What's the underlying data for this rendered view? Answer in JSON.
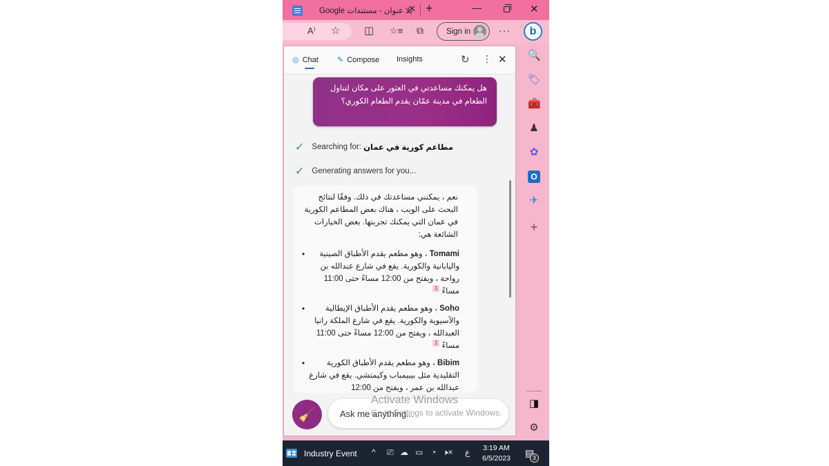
{
  "browser": {
    "tab_title": "بلا عنوان - مستندات Google",
    "tab_close": "✕",
    "new_tab": "+",
    "window_controls": {
      "minimize": "—",
      "close": "✕"
    },
    "toolbar": {
      "read_aloud": "A⁾",
      "favorite": "☆",
      "split_screen": "◫",
      "favorites": "☆≡",
      "collections": "⧉",
      "sign_in_label": "Sign in",
      "more": "···",
      "copilot": "b"
    }
  },
  "panel": {
    "tabs": [
      {
        "label": "Chat",
        "icon": "chat-icon",
        "active": true
      },
      {
        "label": "Compose",
        "icon": "compose-icon",
        "active": false
      },
      {
        "label": "Insights",
        "active": false
      }
    ],
    "refresh": "↻",
    "more": "⋮",
    "close": "✕",
    "user_message": "هل يمكنك مساعدتي في العثور على مكان لتناول الطعام في مدينة عمّان يقدم الطعام الكوري؟",
    "status": [
      {
        "prefix": "Searching for: ",
        "query": "مطاعم كورية في عمان"
      },
      {
        "prefix": "Generating answers for you...",
        "query": ""
      }
    ],
    "answer": {
      "intro": "نعم ، يمكنني مساعدتك في ذلك. وفقًا لنتائج البحث على الويب ، هناك بعض المطاعم الكورية في عمان التي يمكنك تجربتها. بعض الخيارات الشائعة هي:",
      "items": [
        {
          "name": "Tomami",
          "text": "، وهو مطعم يقدم الأطباق الصينية واليابانية والكورية. يقع في شارع عبدالله بن رواحة ، ويفتح من 12:00 مساءً حتى 11:00 مساءً",
          "cite": "1"
        },
        {
          "name": "Soho",
          "text": "، وهو مطعم يقدم الأطباق الإيطالية والآسيوية والكورية. يقع في شارع الملكة رانيا العبدالله ، ويفتح من 12:00 مساءً حتى 11:00 مساءً",
          "cite": "1"
        },
        {
          "name": "Bibim",
          "text": "، وهو مطعم يقدم الأطباق الكورية التقليدية مثل بيبيمباب وكيمتشي. يقع في شارع عبدالله بن عمر ، ويفتح من 12:00",
          "cite": ""
        }
      ]
    },
    "input_placeholder": "Ask me anything...",
    "new_topic_icon": "🧹"
  },
  "watermark": {
    "title": "Activate Windows",
    "subtitle": "Go to Settings to activate Windows."
  },
  "sidebar": {
    "items": [
      {
        "name": "search",
        "glyph": "🔍"
      },
      {
        "name": "shopping",
        "glyph": "🏷"
      },
      {
        "name": "tools",
        "glyph": "🧰"
      },
      {
        "name": "games",
        "glyph": "♟"
      },
      {
        "name": "microsoft-365",
        "glyph": "✿"
      },
      {
        "name": "outlook",
        "glyph": "O"
      },
      {
        "name": "drop",
        "glyph": "✈"
      },
      {
        "name": "add",
        "glyph": "+"
      }
    ],
    "hide_sidebar": "◨",
    "settings": "⚙"
  },
  "taskbar": {
    "widgets_label": "Industry Event",
    "tray": {
      "chevron": "^",
      "meet": "⎚",
      "onedrive": "☁",
      "battery": "▭",
      "wifi": "◔",
      "volume": "🕨×",
      "lang": "ع"
    },
    "time": "3:19 AM",
    "date": "6/5/2023",
    "notification_count": "3"
  },
  "colors": {
    "title_bar": "#f2709e",
    "frame": "#f6b6cc",
    "user_bubble": "#8e3287",
    "check": "#3c9a4a",
    "taskbar": "#1d2431"
  }
}
